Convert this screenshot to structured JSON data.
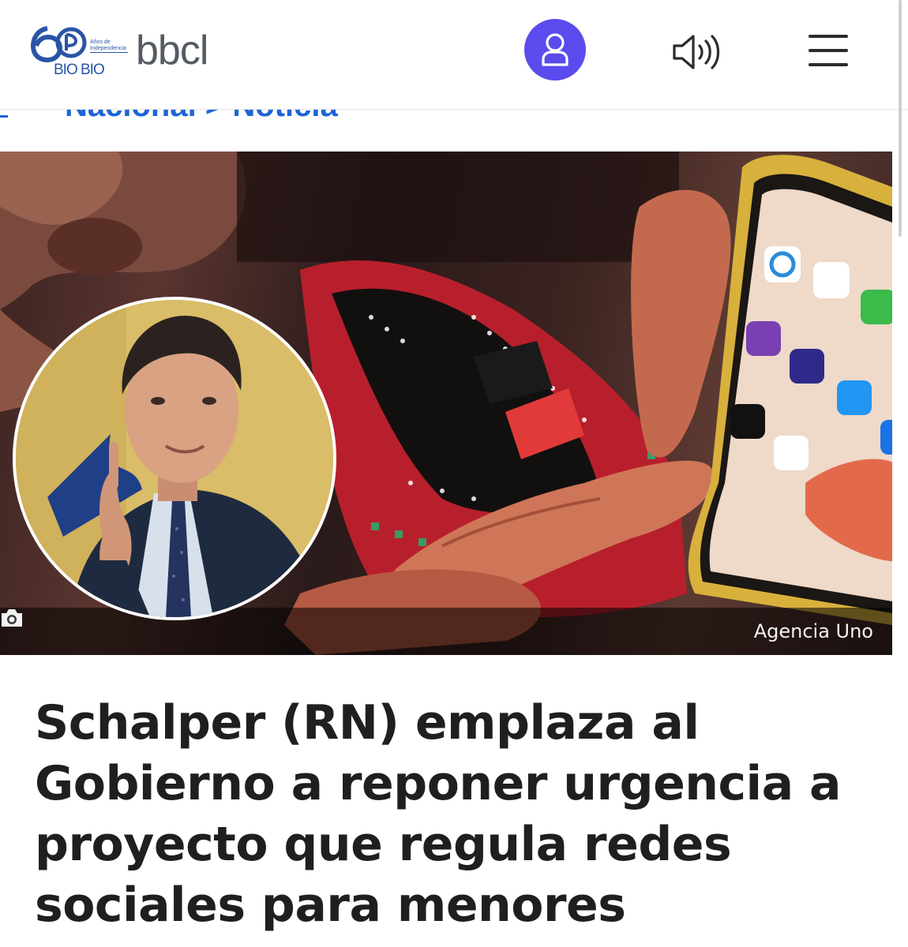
{
  "header": {
    "logo_years_text": "Años de Independencia",
    "logo_biobio": "BIO BIO",
    "logo_bbcl": "bbcl",
    "icons": {
      "user": "user-icon",
      "audio": "speaker-icon",
      "menu": "hamburger-menu-icon"
    },
    "accent_color": "#5b4bec"
  },
  "breadcrumb": {
    "section": "Nacional",
    "separator": ">",
    "current": "Noticia"
  },
  "hero": {
    "photo_credit": "Agencia Uno",
    "credit_icon": "camera-icon"
  },
  "article": {
    "headline": "Schalper (RN) emplaza al Gobierno a reponer urgencia a proyecto que regula redes sociales para menores"
  }
}
